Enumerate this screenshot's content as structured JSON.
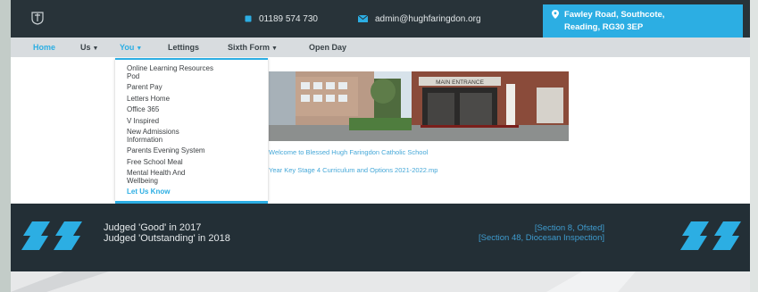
{
  "header": {
    "phone": "01189 574 730",
    "email": "admin@hughfaringdon.org",
    "address_line1": "Fawley Road, Southcote,",
    "address_line2": "Reading, RG30 3EP"
  },
  "nav": {
    "items": [
      {
        "label": "Home"
      },
      {
        "label": "Us"
      },
      {
        "label": "You"
      },
      {
        "label": "Lettings"
      },
      {
        "label": "Sixth Form"
      },
      {
        "label": "Open Day"
      }
    ]
  },
  "dropdown": {
    "items": [
      {
        "label_l1": "Online Learning Resources",
        "label_l2": "Pod"
      },
      {
        "label_l1": "Parent Pay",
        "label_l2": ""
      },
      {
        "label_l1": "Letters Home",
        "label_l2": ""
      },
      {
        "label_l1": "Office 365",
        "label_l2": ""
      },
      {
        "label_l1": "V Inspired",
        "label_l2": ""
      },
      {
        "label_l1": "New Admissions",
        "label_l2": "Information"
      },
      {
        "label_l1": "Parents Evening System",
        "label_l2": ""
      },
      {
        "label_l1": "Free School Meal",
        "label_l2": ""
      },
      {
        "label_l1": "Mental Health And",
        "label_l2": "Wellbeing"
      },
      {
        "label_l1": "Let Us Know",
        "label_l2": ""
      }
    ]
  },
  "main": {
    "hero_sign": "MAIN ENTRANCE",
    "link1": "Welcome to Blessed Hugh Faringdon Catholic School",
    "link2": "Year Key Stage 4 Curriculum and Options 2021-2022.mp"
  },
  "band": {
    "judged1": "Judged 'Good' in 2017",
    "judged2": "Judged 'Outstanding' in 2018",
    "section1": "[Section 8, Ofsted]",
    "section2": "[Section 48, Diocesan Inspection]"
  },
  "colors": {
    "accent": "#2caee3",
    "dark": "#283339",
    "band": "#232f36"
  },
  "icons": {
    "logo": "school-crest-icon",
    "phone": "phone-icon",
    "email": "envelope-icon",
    "address": "map-pin-icon",
    "quote_open": "open-quote-icon",
    "quote_close": "close-quote-icon"
  }
}
